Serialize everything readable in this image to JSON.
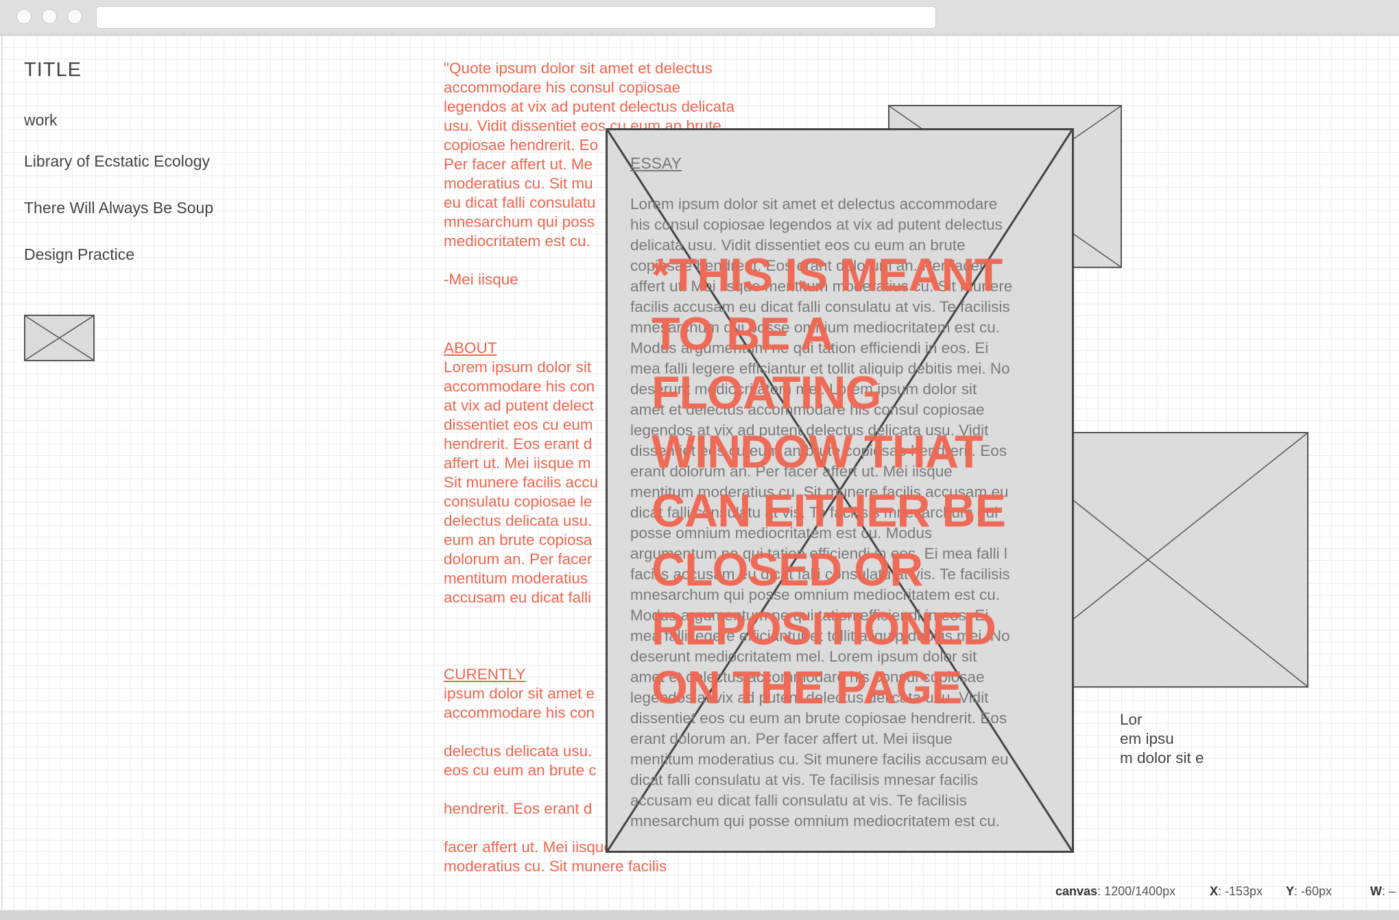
{
  "nav": {
    "title": "TITLE",
    "items": [
      "work",
      "Library of Ecstatic Ecology",
      "There Will Always Be Soup",
      "Design Practice"
    ]
  },
  "quote": {
    "lines": [
      "\"Quote ipsum dolor sit amet et delectus",
      "accommodare his consul copiosae",
      "legendos at vix ad putent delectus delicata",
      "usu. Vidit dissentiet eos cu eum an brute",
      "copiosae hendrerit. Eo",
      "Per facer affert ut. Me",
      "moderatius cu. Sit mu",
      "eu dicat falli consulatu",
      "mnesarchum qui poss",
      "mediocritatem est cu."
    ],
    "author": "-Mei iisque"
  },
  "about": {
    "heading": "ABOUT",
    "lines": [
      "Lorem ipsum dolor sit",
      "accommodare his con",
      "at vix ad putent delect",
      "dissentiet eos cu eum",
      "hendrerit. Eos erant d",
      "affert ut. Mei iisque m",
      "Sit munere facilis accu",
      "consulatu copiosae le",
      "delectus delicata usu.",
      "eum an brute copiosa",
      "dolorum an. Per facer",
      "mentitum moderatius",
      "accusam eu dicat falli"
    ]
  },
  "currently": {
    "heading": "CURENTLY",
    "lines": [
      "ipsum dolor sit amet e",
      "accommodare his con",
      "",
      "delectus delicata usu.",
      "eos cu eum an brute c",
      "",
      "hendrerit. Eos erant d",
      "",
      "facer affert ut. Mei iisque mentitum",
      "moderatius cu. Sit munere facilis"
    ]
  },
  "essay": {
    "label": "ESSAY",
    "lines": [
      "Lorem ipsum dolor sit amet et delectus accommodare",
      "his consul copiosae legendos at vix ad putent delectus",
      "delicata usu. Vidit dissentiet eos cu eum an brute",
      "copiosae hendrerit. Eos erant dolorum an. Per facer",
      "affert ut. Mei iisque mentitum moderatius cu. Sit munere",
      "facilis accusam eu dicat falli consulatu at vis. Te facilisis",
      "mnesarchum qui posse omnium mediocritatem est cu.",
      "Modus argumentum ne qui tation efficiendi in eos. Ei",
      "mea falli legere efficiantur et tollit aliquip debitis mei. No",
      "deserunt mediocritatem mel. Lorem ipsum dolor sit",
      "amet et delectus accommodare his consul copiosae",
      "legendos at vix ad putent delectus delicata usu. Vidit",
      "dissentiet eos cu eum an brute copiosae hendrerit. Eos",
      "erant dolorum an. Per facer affert ut. Mei iisque",
      "mentitum moderatius cu. Sit munere facilis accusam eu",
      "dicat falli consulatu at vis. Te facilisis mnesarchum qui",
      "posse omnium mediocritatem est cu. Modus",
      "argumentum ne qui tation efficiendi in eos. Ei mea falli l",
      "facilis accusam eu dicat falli consulatu at vis. Te facilisis",
      "mnesarchum qui posse omnium mediocritatem est cu.",
      "Modus argumentum ne qui tation efficiendi in eos. Ei",
      "mea falli legere efficiantur et tollit aliquip debitis mei. No",
      "deserunt mediocritatem mel. Lorem ipsum dolor sit",
      "amet et delectus accommodare his consul copiosae",
      "legendos at vix ad putent delectus delicata usu. Vidit",
      "dissentiet eos cu eum an brute copiosae hendrerit. Eos",
      "erant dolorum an. Per facer affert ut. Mei iisque",
      "mentitum moderatius cu. Sit munere facilis accusam eu",
      "dicat falli consulatu at vis. Te facilisis mnesar facilis",
      "accusam eu dicat falli consulatu at vis. Te facilisis",
      "mnesarchum qui posse omnium mediocritatem est cu."
    ]
  },
  "annotation": {
    "lines": [
      "*THIS IS MEANT",
      "TO BE A",
      "FLOATING",
      "WINDOW THAT",
      "CAN EITHER BE",
      "CLOSED OR",
      "REPOSITIONED",
      "ON THE PAGE"
    ]
  },
  "right_text": {
    "lines": [
      "Lor",
      "em ipsu",
      "m dolor sit e"
    ]
  },
  "status": {
    "canvas_label": "canvas",
    "canvas_value": ": 1200/1400px",
    "x_label": "X",
    "x_value": ": -153px",
    "y_label": "Y",
    "y_value": ": -60px",
    "w_label": "W",
    "w_value": ": –"
  },
  "colors": {
    "accent": "#f06650",
    "text": "#444444",
    "placeholder": "#dcdcdc"
  }
}
